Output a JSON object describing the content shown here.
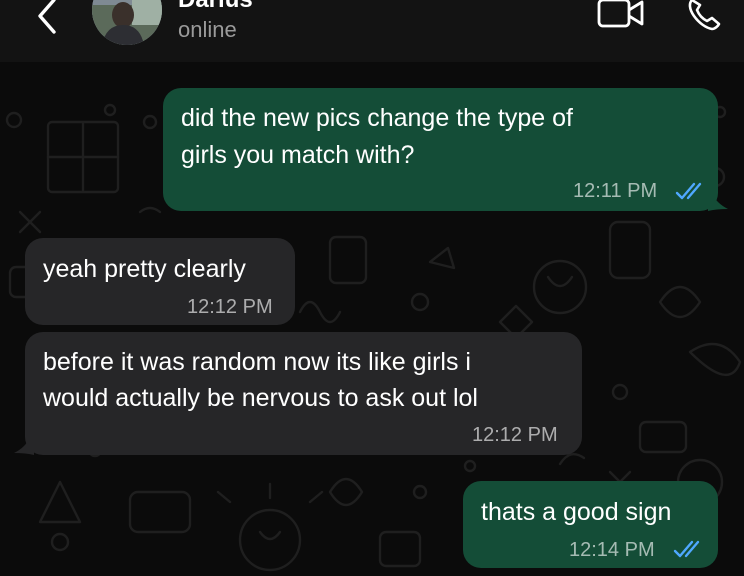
{
  "header": {
    "contact_name": "Darius",
    "contact_status": "online",
    "icons": [
      "chevron-left-icon",
      "video-camera-icon",
      "phone-icon"
    ]
  },
  "messages": [
    {
      "direction": "outgoing",
      "lines": [
        "did the new pics change the type of",
        "girls you match with?"
      ],
      "time": "12:11 PM",
      "read": true
    },
    {
      "direction": "incoming",
      "lines": [
        "yeah pretty clearly"
      ],
      "time": "12:12 PM"
    },
    {
      "direction": "incoming",
      "lines": [
        "before it was random now its like girls i",
        "would actually be nervous to ask out lol"
      ],
      "time": "12:12 PM"
    },
    {
      "direction": "outgoing",
      "lines": [
        "thats a good sign"
      ],
      "time": "12:14 PM",
      "read": true
    }
  ],
  "colors": {
    "outgoing_bubble": "#144d37",
    "incoming_bubble": "#262628",
    "read_ticks": "#4fa8ff",
    "chat_background": "#0b0b0b",
    "header_background": "#131313"
  }
}
